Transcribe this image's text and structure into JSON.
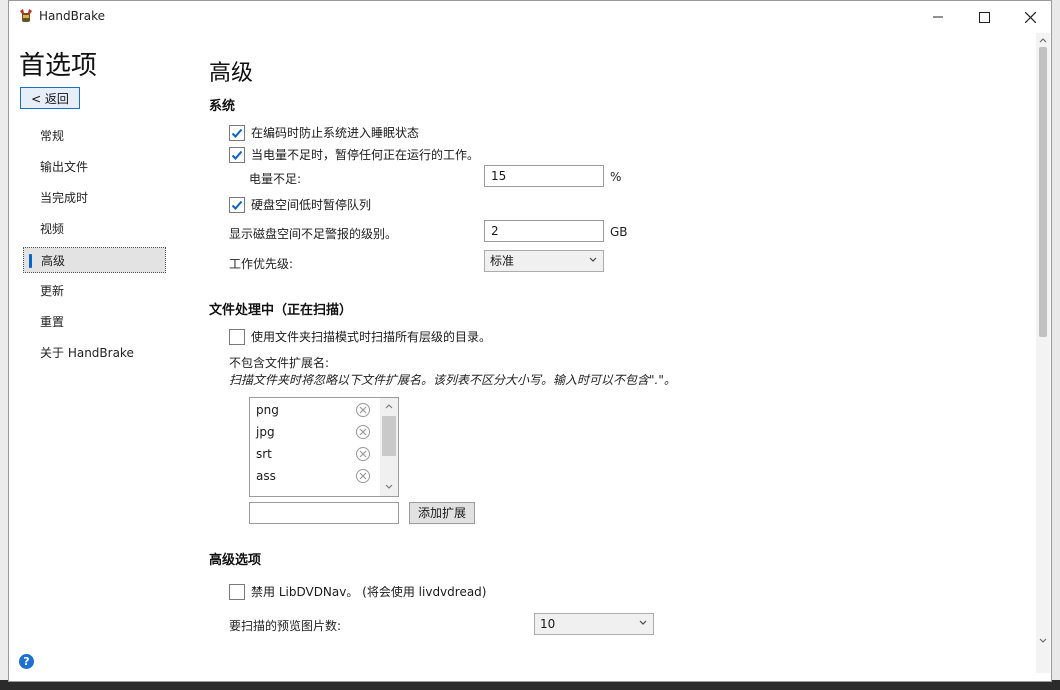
{
  "window": {
    "title": "HandBrake"
  },
  "sidebar": {
    "heading": "首选项",
    "back_label": "< 返回",
    "items": [
      {
        "label": "常规"
      },
      {
        "label": "输出文件"
      },
      {
        "label": "当完成时"
      },
      {
        "label": "视频"
      },
      {
        "label": "高级",
        "selected": true
      },
      {
        "label": "更新"
      },
      {
        "label": "重置"
      },
      {
        "label": "关于 HandBrake"
      }
    ]
  },
  "page": {
    "title": "高级",
    "system": {
      "heading": "系统",
      "prevent_sleep": {
        "label": "在编码时防止系统进入睡眠状态",
        "checked": true
      },
      "pause_low_battery": {
        "label": "当电量不足时，暂停任何正在运行的工作。",
        "checked": true
      },
      "battery_level": {
        "label": "电量不足:",
        "value": "15",
        "unit": "%"
      },
      "pause_low_disk": {
        "label": "硬盘空间低时暂停队列",
        "checked": true
      },
      "disk_warning": {
        "label": "显示磁盘空间不足警报的级别。",
        "value": "2",
        "unit": "GB"
      },
      "priority": {
        "label": "工作优先级:",
        "value": "标准"
      }
    },
    "file_handling": {
      "heading": "文件处理中（正在扫描）",
      "recursive_scan": {
        "label": "使用文件夹扫描模式时扫描所有层级的目录。",
        "checked": false
      },
      "excluded_label": "不包含文件扩展名:",
      "excluded_note": "扫描文件夹时将忽略以下文件扩展名。该列表不区分大小写。输入时可以不包含\".\"。",
      "extensions": [
        "png",
        "jpg",
        "srt",
        "ass"
      ],
      "add_input_value": "",
      "add_button_label": "添加扩展"
    },
    "advanced": {
      "heading": "高级选项",
      "disable_libdvdnav": {
        "label": "禁用 LibDVDNav。 (将会使用 livdvdread)",
        "checked": false
      },
      "preview_count": {
        "label": "要扫描的预览图片数:",
        "value": "10"
      }
    }
  },
  "colors": {
    "accent": "#0a64c4",
    "selected_bg": "#e3e3e3",
    "help_icon": "#1d6fd1"
  }
}
